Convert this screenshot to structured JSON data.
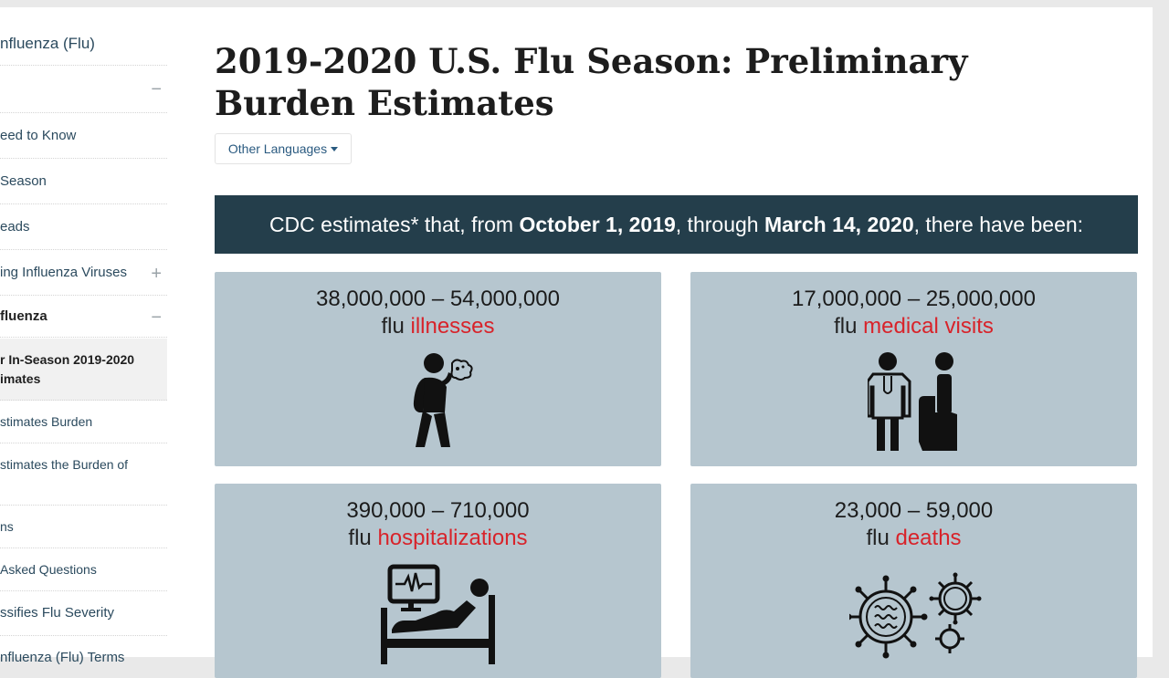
{
  "sidebar": {
    "items": [
      {
        "label": "nfluenza (Flu)"
      },
      {
        "label": ""
      },
      {
        "label": "eed to Know"
      },
      {
        "label": "Season"
      },
      {
        "label": "eads"
      },
      {
        "label": "ing Influenza Viruses"
      },
      {
        "label": "fluenza"
      },
      {
        "label": "r In-Season 2019-2020"
      },
      {
        "label": "imates"
      },
      {
        "label": "stimates Burden"
      },
      {
        "label": "stimates the Burden of"
      },
      {
        "label": "ns"
      },
      {
        "label": "Asked Questions"
      },
      {
        "label": "ssifies Flu Severity"
      },
      {
        "label": "nfluenza (Flu) Terms"
      }
    ],
    "toggles": {
      "minus": "−",
      "plus": "+"
    }
  },
  "main": {
    "title": "2019-2020 U.S. Flu Season: Preliminary Burden Estimates",
    "language_button": "Other Languages",
    "banner": {
      "part1": "CDC estimates* that, from ",
      "date1": "October 1, 2019",
      "part2": ", through ",
      "date2": "March 14, 2020",
      "part3": ", there have been:"
    },
    "cards": [
      {
        "range": "38,000,000 – 54,000,000",
        "prefix": "flu",
        "highlight": "illnesses",
        "icon": "sick-person-icon"
      },
      {
        "range": "17,000,000 – 25,000,000",
        "prefix": "flu",
        "highlight": "medical visits",
        "icon": "doctor-patient-icon"
      },
      {
        "range": "390,000 – 710,000",
        "prefix": "flu",
        "highlight": "hospitalizations",
        "icon": "hospital-bed-icon"
      },
      {
        "range": "23,000 – 59,000",
        "prefix": "flu",
        "highlight": "deaths",
        "icon": "virus-icon"
      }
    ]
  },
  "colors": {
    "banner_bg": "#243e4b",
    "card_bg": "#b6c6cf",
    "highlight": "#d8232a",
    "link": "#2a5a80"
  }
}
